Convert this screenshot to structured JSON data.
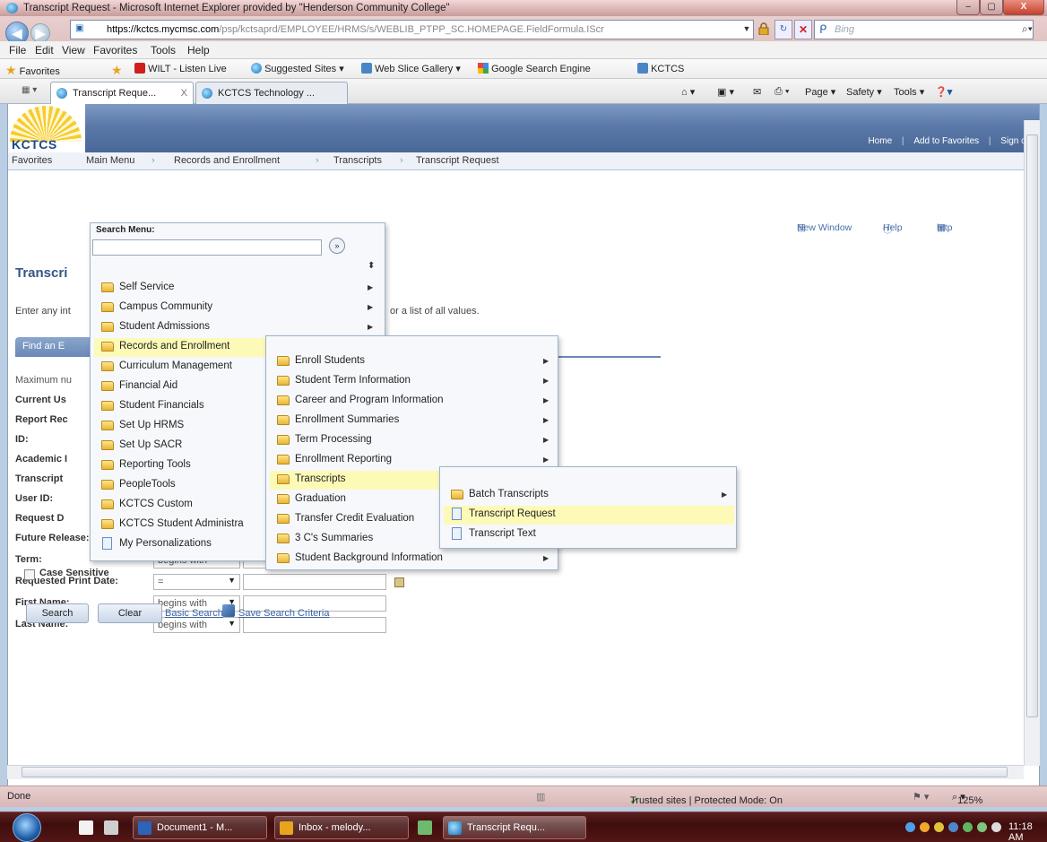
{
  "window": {
    "title": "Transcript Request - Microsoft Internet Explorer provided by \"Henderson Community College\"",
    "min": "–",
    "max": "▢",
    "close": "X"
  },
  "address": {
    "url_host": "https://kctcs.mycmsc.com",
    "url_path": "/psp/kctsaprd/EMPLOYEE/HRMS/s/WEBLIB_PTPP_SC.HOMEPAGE.FieldFormula.IScr",
    "search_placeholder": "Bing"
  },
  "menubar": [
    "File",
    "Edit",
    "View",
    "Favorites",
    "Tools",
    "Help"
  ],
  "favorites_bar": {
    "favorites": "Favorites",
    "items": [
      "WILT - Listen Live",
      "Suggested Sites ▾",
      "Web Slice Gallery ▾",
      "Google Search Engine",
      "KCTCS"
    ]
  },
  "tabs": [
    {
      "label": "Transcript Reque...",
      "close": "X"
    },
    {
      "label": "KCTCS Technology ..."
    }
  ],
  "command_bar": [
    "Page ▾",
    "Safety ▾",
    "Tools ▾"
  ],
  "banner": {
    "logo": "KCTCS",
    "links": [
      "Home",
      "Add to Favorites",
      "Sign out"
    ]
  },
  "breadcrumb": [
    "Favorites",
    "Main Menu",
    "Records and Enrollment",
    "Transcripts",
    "Transcript Request"
  ],
  "page_tools": [
    "New Window",
    "Help",
    "http"
  ],
  "page": {
    "heading": "Transcri",
    "instructions_left": "Enter any int",
    "instructions_right": "or a list of all values.",
    "find_tab": "Find an E",
    "fields": [
      {
        "label": "Maximum nu"
      },
      {
        "label": "Current Us"
      },
      {
        "label": "Report Rec"
      },
      {
        "label": "ID:"
      },
      {
        "label": "Academic I"
      },
      {
        "label": "Transcript"
      },
      {
        "label": "User ID:"
      },
      {
        "label": "Request D"
      },
      {
        "label": "Future Release:",
        "operator": "="
      },
      {
        "label": "Term:",
        "operator": "begins with"
      },
      {
        "label": "Requested Print Date:",
        "operator": "="
      },
      {
        "label": "First Name:",
        "operator": "begins with"
      },
      {
        "label": "Last Name:",
        "operator": "begins with"
      }
    ],
    "case_sensitive": "Case Sensitive",
    "search_button": "Search",
    "clear_button": "Clear",
    "basic_search": "Basic Search",
    "save_search": "Save Search Criteria"
  },
  "search_menu": {
    "title": "Search Menu:",
    "go": "»",
    "items": [
      {
        "label": "Self Service",
        "type": "folder",
        "submenu": true
      },
      {
        "label": "Campus Community",
        "type": "folder",
        "submenu": true
      },
      {
        "label": "Student Admissions",
        "type": "folder",
        "submenu": true
      },
      {
        "label": "Records and Enrollment",
        "type": "folder",
        "submenu": true,
        "highlighted": true
      },
      {
        "label": "Curriculum Management",
        "type": "folder",
        "submenu": true
      },
      {
        "label": "Financial Aid",
        "type": "folder",
        "submenu": true
      },
      {
        "label": "Student Financials",
        "type": "folder",
        "submenu": true
      },
      {
        "label": "Set Up HRMS",
        "type": "folder",
        "submenu": true
      },
      {
        "label": "Set Up SACR",
        "type": "folder",
        "submenu": true
      },
      {
        "label": "Reporting Tools",
        "type": "folder",
        "submenu": true
      },
      {
        "label": "PeopleTools",
        "type": "folder",
        "submenu": true
      },
      {
        "label": "KCTCS Custom",
        "type": "folder",
        "submenu": true
      },
      {
        "label": "KCTCS Student Administra",
        "type": "folder",
        "submenu": true
      },
      {
        "label": "My Personalizations",
        "type": "doc",
        "submenu": false
      }
    ]
  },
  "records_menu": {
    "items": [
      {
        "label": "Enroll Students",
        "submenu": true
      },
      {
        "label": "Student Term Information",
        "submenu": true
      },
      {
        "label": "Career and Program Information",
        "submenu": true
      },
      {
        "label": "Enrollment Summaries",
        "submenu": true
      },
      {
        "label": "Term Processing",
        "submenu": true
      },
      {
        "label": "Enrollment Reporting",
        "submenu": true
      },
      {
        "label": "Transcripts",
        "submenu": true,
        "highlighted": true
      },
      {
        "label": "Graduation",
        "submenu": true
      },
      {
        "label": "Transfer Credit Evaluation",
        "submenu": true
      },
      {
        "label": "3 C's Summaries",
        "submenu": true
      },
      {
        "label": "Student Background Information",
        "submenu": true
      }
    ]
  },
  "transcripts_menu": {
    "items": [
      {
        "label": "Batch Transcripts",
        "type": "folder",
        "submenu": true
      },
      {
        "label": "Transcript Request",
        "type": "doc",
        "highlighted": true
      },
      {
        "label": "Transcript Text",
        "type": "doc"
      }
    ]
  },
  "status": {
    "left": "Done",
    "zone": "Trusted sites | Protected Mode: On",
    "zoom": "125%"
  },
  "taskbar": {
    "apps": [
      "Document1 - M...",
      "Inbox - melody...",
      "Transcript Requ..."
    ],
    "clock": "11:18 AM"
  }
}
